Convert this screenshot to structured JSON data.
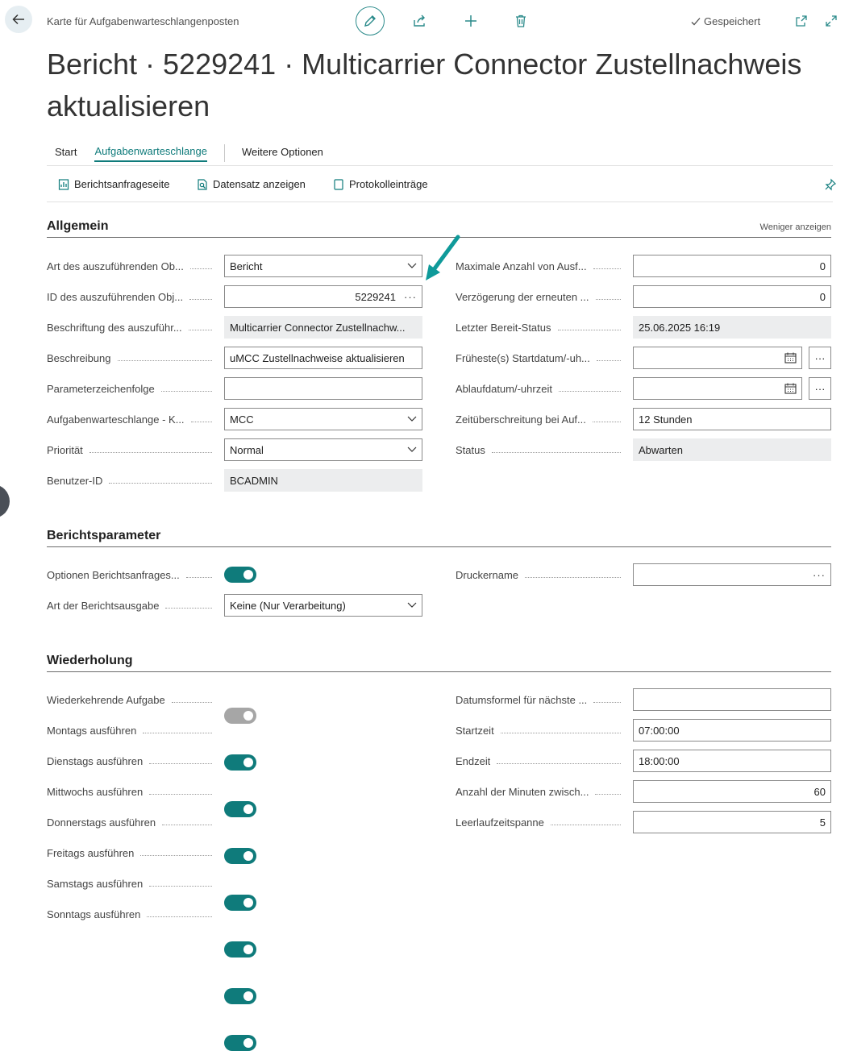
{
  "header": {
    "breadcrumb": "Karte für Aufgabenwarteschlangenposten",
    "saved_label": "Gespeichert",
    "title": "Bericht · 5229241 · Multicarrier Connector Zustellnachweis aktualisieren"
  },
  "tabs": [
    "Start",
    "Aufgabenwarteschlange",
    "Weitere Optionen"
  ],
  "actions": [
    "Berichtsanfrageseite",
    "Datensatz anzeigen",
    "Protokolleinträge"
  ],
  "allgemein": {
    "title": "Allgemein",
    "show_less": "Weniger anzeigen",
    "left": [
      {
        "label": "Art des auszuführenden Ob...",
        "value": "Bericht"
      },
      {
        "label": "ID des auszuführenden Obj...",
        "value": "5229241"
      },
      {
        "label": "Beschriftung des auszuführ...",
        "value": "Multicarrier Connector Zustellnachw..."
      },
      {
        "label": "Beschreibung",
        "value": "uMCC Zustellnachweise aktualisieren"
      },
      {
        "label": "Parameterzeichenfolge",
        "value": ""
      },
      {
        "label": "Aufgabenwarteschlange - K...",
        "value": "MCC"
      },
      {
        "label": "Priorität",
        "value": "Normal"
      },
      {
        "label": "Benutzer-ID",
        "value": "BCADMIN"
      }
    ],
    "right": [
      {
        "label": "Maximale Anzahl von Ausf...",
        "value": "0"
      },
      {
        "label": "Verzögerung der erneuten ...",
        "value": "0"
      },
      {
        "label": "Letzter Bereit-Status",
        "value": "25.06.2025 16:19"
      },
      {
        "label": "Früheste(s) Startdatum/-uh...",
        "value": ""
      },
      {
        "label": "Ablaufdatum/-uhrzeit",
        "value": ""
      },
      {
        "label": "Zeitüberschreitung bei Auf...",
        "value": "12 Stunden"
      },
      {
        "label": "Status",
        "value": "Abwarten"
      }
    ]
  },
  "berichtsparameter": {
    "title": "Berichtsparameter",
    "options_label": "Optionen Berichtsanfrages...",
    "options_on": true,
    "output_label": "Art der Berichtsausgabe",
    "output_value": "Keine (Nur Verarbeitung)",
    "printer_label": "Druckername",
    "printer_value": ""
  },
  "wiederholung": {
    "title": "Wiederholung",
    "left": [
      {
        "label": "Wiederkehrende Aufgabe",
        "on": false,
        "disabled": true
      },
      {
        "label": "Montags ausführen",
        "on": true
      },
      {
        "label": "Dienstags ausführen",
        "on": true
      },
      {
        "label": "Mittwochs ausführen",
        "on": true
      },
      {
        "label": "Donnerstags ausführen",
        "on": true
      },
      {
        "label": "Freitags ausführen",
        "on": true
      },
      {
        "label": "Samstags ausführen",
        "on": true
      },
      {
        "label": "Sonntags ausführen",
        "on": true
      }
    ],
    "right": [
      {
        "label": "Datumsformel für nächste ...",
        "value": ""
      },
      {
        "label": "Startzeit",
        "value": "07:00:00"
      },
      {
        "label": "Endzeit",
        "value": "18:00:00"
      },
      {
        "label": "Anzahl der Minuten zwisch...",
        "value": "60"
      },
      {
        "label": "Leerlaufzeitspanne",
        "value": "5"
      }
    ]
  },
  "colors": {
    "accent": "#0f7b7b",
    "annotation_arrow": "#0f9a9a"
  },
  "icons": [
    "back-arrow-icon",
    "pencil-icon",
    "share-icon",
    "plus-icon",
    "trash-icon",
    "checkmark-icon",
    "open-new-window-icon",
    "expand-icon",
    "report-icon",
    "magnifier-doc-icon",
    "document-icon",
    "pin-icon",
    "chevron-down-icon",
    "calendar-icon"
  ]
}
